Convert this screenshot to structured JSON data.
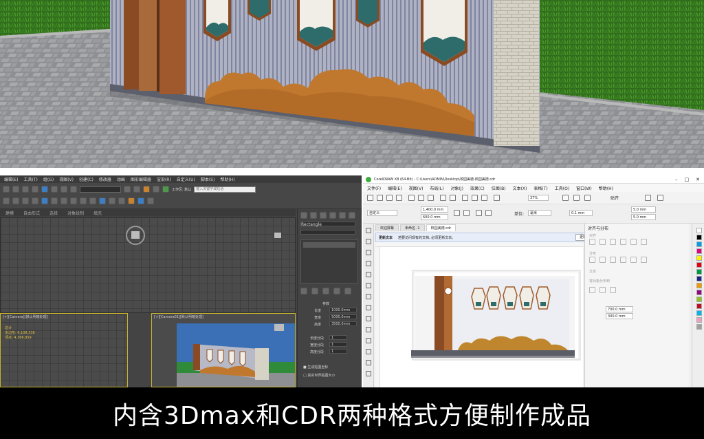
{
  "max": {
    "menu": [
      "编辑(E)",
      "工具(T)",
      "组(G)",
      "视图(V)",
      "创建(C)",
      "修改器",
      "动画",
      "图形编辑器",
      "渲染(R)",
      "自定义(U)",
      "脚本(S)",
      "帮助(H)"
    ],
    "tabs": [
      "建模",
      "自由形式",
      "选择",
      "对象绘制",
      "填充"
    ],
    "viewport_labels": [
      "[+][Camera][默认明暗处理]",
      "[+][Camera01][默认明暗处理]"
    ],
    "workspace_label": "工作区: 默认",
    "search_placeholder": "键入关键字或短语",
    "cmd_title": "Rectangle",
    "cmd_section": "参数",
    "cmd_fields": [
      {
        "label": "长度",
        "value": "1000.0mm"
      },
      {
        "label": "宽度",
        "value": "5000.0mm"
      },
      {
        "label": "高度",
        "value": "3500.0mm"
      }
    ],
    "cmd_segs": [
      {
        "label": "长度分段",
        "value": "1"
      },
      {
        "label": "宽度分段",
        "value": "1"
      },
      {
        "label": "高度分段",
        "value": "1"
      }
    ],
    "cmd_checks": [
      "生成贴图坐标",
      "真实世界贴图大小"
    ],
    "stats": [
      "总计",
      "多边形: 6,108,338",
      "顶点: 4,366,959"
    ]
  },
  "cdr": {
    "title": "CorelDRAW X8 (64-Bit) - C:\\Users\\ADMIN\\Desktop\\校园美德-校园美德.cdr",
    "menu": [
      "文件(F)",
      "编辑(E)",
      "视图(V)",
      "布局(L)",
      "对象(J)",
      "效果(C)",
      "位图(B)",
      "文本(X)",
      "表格(T)",
      "工具(O)",
      "窗口(W)",
      "帮助(H)"
    ],
    "paper": "自定义",
    "width": "1,400.0 mm",
    "height": "600.0 mm",
    "unit_label": "单位:",
    "unit": "毫米",
    "zoom": "37%",
    "snap": "贴齐",
    "nudge": "0.1 mm",
    "dup_x": "5.0 mm",
    "dup_y": "5.0 mm",
    "doc_tabs": [
      "欢迎屏幕",
      "未命名 -1",
      "校园美德.cdr"
    ],
    "info_title": "更新文本",
    "info_text": "若要访问现有的文档, 必须更新文本。",
    "info_button": "更新",
    "docker_title": "对齐与分布",
    "docker_sections": [
      "对齐",
      "分布",
      "文本",
      "将对象分布到"
    ],
    "docker_values": [
      "700.0 mm",
      "300.0 mm"
    ]
  },
  "caption": "内含3Dmax和CDR两种格式方便制作成品"
}
